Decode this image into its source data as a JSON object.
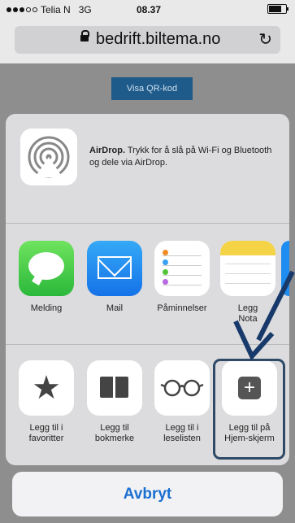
{
  "status_bar": {
    "carrier": "Telia N",
    "network": "3G",
    "time": "08.37",
    "battery_level": 0.85
  },
  "browser": {
    "url": "bedrift.biltema.no"
  },
  "page": {
    "qr_button": "Visa QR-kod"
  },
  "share_sheet": {
    "airdrop": {
      "title": "AirDrop.",
      "description": "Trykk for å slå på Wi-Fi og Bluetooth og dele via AirDrop."
    },
    "apps": [
      {
        "label": "Melding",
        "icon": "messages-icon"
      },
      {
        "label": "Mail",
        "icon": "mail-icon"
      },
      {
        "label": "Påminnelser",
        "icon": "reminders-icon"
      },
      {
        "label_line1": "Legg",
        "label_line2": "Nota",
        "icon": "notes-icon"
      }
    ],
    "actions": [
      {
        "label_line1": "Legg til i",
        "label_line2": "favoritter",
        "icon": "star-icon"
      },
      {
        "label_line1": "Legg til",
        "label_line2": "bokmerke",
        "icon": "book-icon"
      },
      {
        "label_line1": "Legg til i",
        "label_line2": "leselisten",
        "icon": "glasses-icon"
      },
      {
        "label_line1": "Legg til på",
        "label_line2": "Hjem-skjerm",
        "icon": "add-icon"
      }
    ]
  },
  "cancel_label": "Avbryt",
  "colors": {
    "highlight": "#2e4a66",
    "cancel_text": "#1b6fd1",
    "qr_button": "#1f5b8a"
  }
}
